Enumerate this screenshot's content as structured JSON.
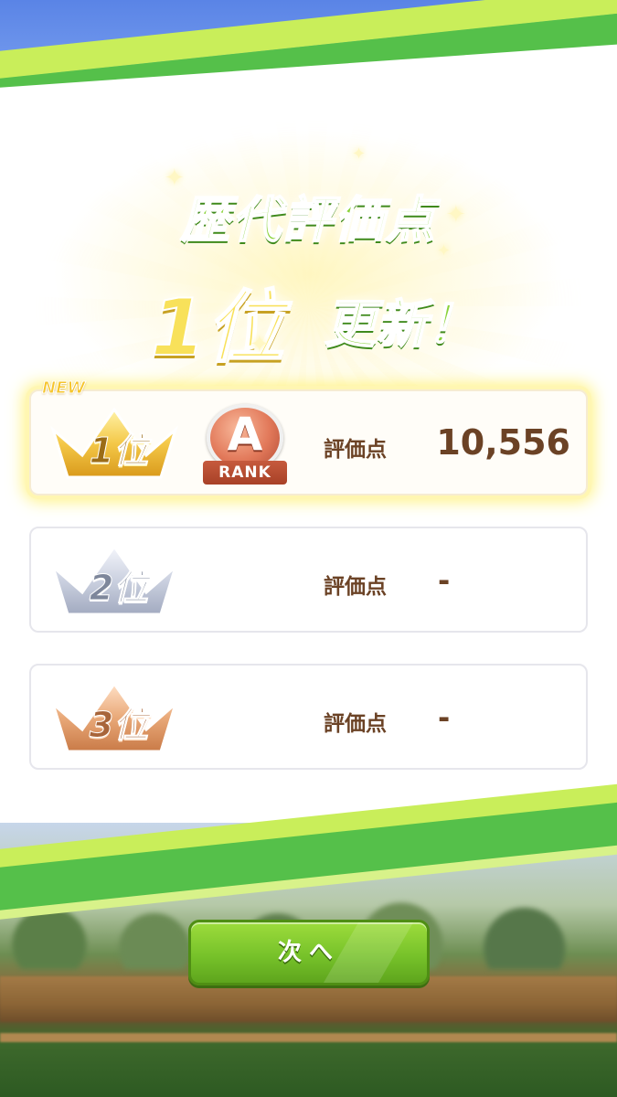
{
  "title": {
    "line1": "歴代評価点",
    "rank": "1位",
    "update": "更新！"
  },
  "rankings": [
    {
      "crown_label": "1位",
      "crown_color": "gold",
      "is_new": true,
      "new_label": "NEW",
      "rank_badge": {
        "letter": "A",
        "ribbon": "RANK"
      },
      "score_label": "評価点",
      "score": "10,556"
    },
    {
      "crown_label": "2位",
      "crown_color": "silver",
      "is_new": false,
      "score_label": "評価点",
      "score": "-"
    },
    {
      "crown_label": "3位",
      "crown_color": "bronze",
      "is_new": false,
      "score_label": "評価点",
      "score": "-"
    }
  ],
  "next_button": {
    "label": "次へ"
  },
  "colors": {
    "accent_green": "#8ad23a",
    "brown_text": "#6b4225",
    "gold": "#f8e15a"
  }
}
